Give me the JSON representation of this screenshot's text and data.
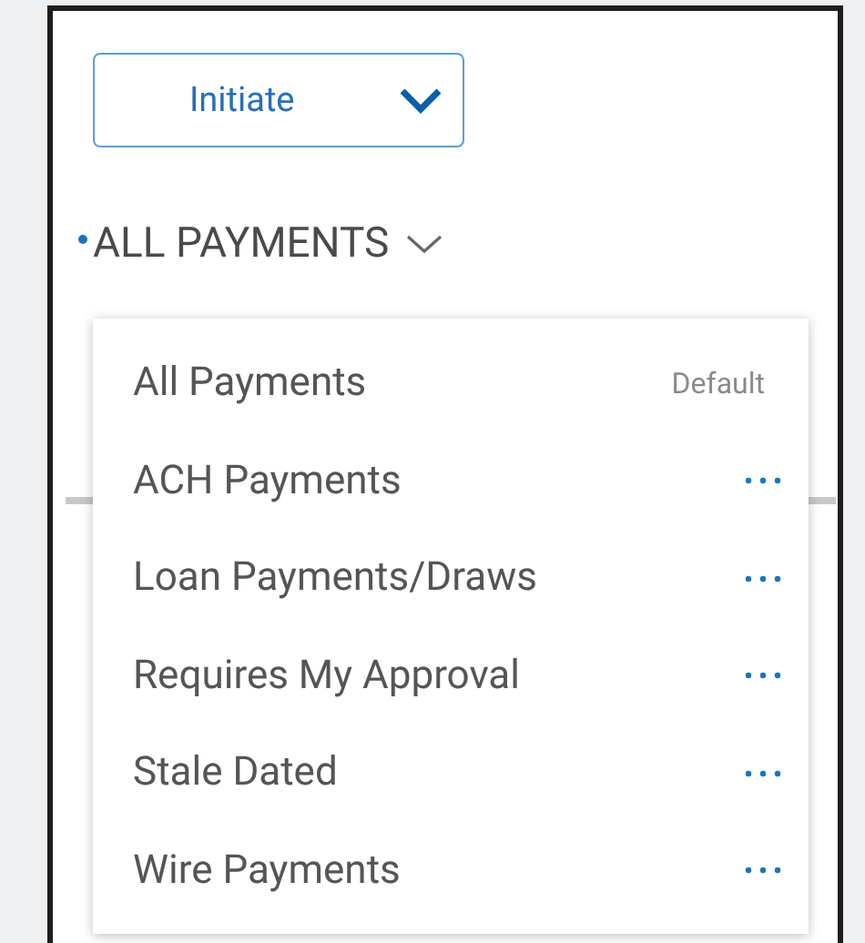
{
  "initiate_button": {
    "label": "Initiate"
  },
  "view_selector": {
    "label": "ALL PAYMENTS",
    "expanded": true
  },
  "menu": {
    "items": [
      {
        "label": "All Payments",
        "kind": "default",
        "badge": "Default"
      },
      {
        "label": "ACH Payments",
        "kind": "actions"
      },
      {
        "label": "Loan Payments/Draws",
        "kind": "actions"
      },
      {
        "label": "Requires My Approval",
        "kind": "actions"
      },
      {
        "label": "Stale Dated",
        "kind": "actions"
      },
      {
        "label": "Wire Payments",
        "kind": "actions"
      }
    ]
  }
}
